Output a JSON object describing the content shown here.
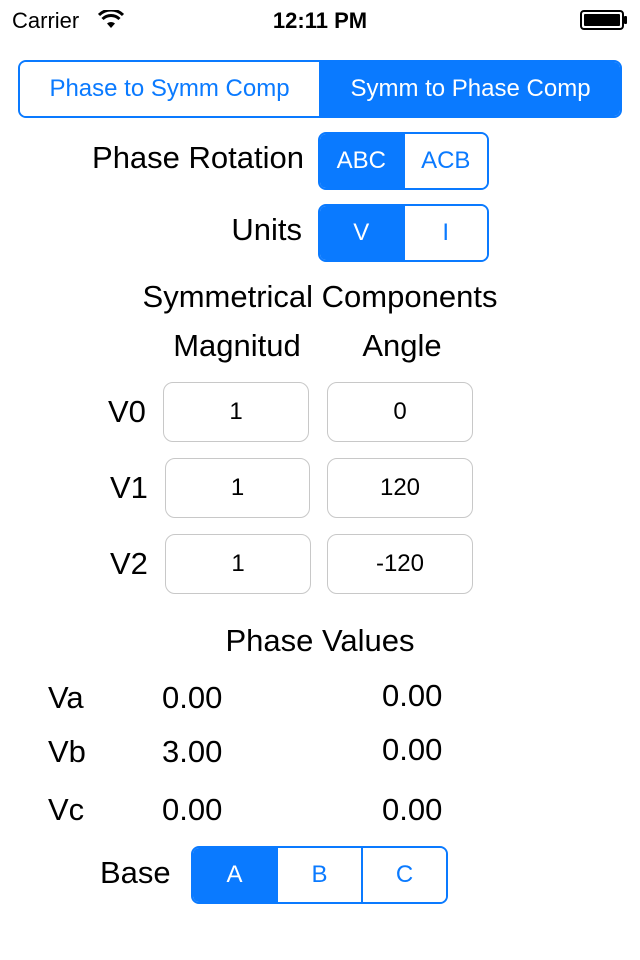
{
  "status_bar": {
    "carrier": "Carrier",
    "time": "12:11 PM"
  },
  "mode_tabs": {
    "options": [
      "Phase to Symm Comp",
      "Symm to Phase Comp"
    ],
    "selected": 1
  },
  "phase_rotation": {
    "label": "Phase Rotation",
    "options": [
      "ABC",
      "ACB"
    ],
    "selected": 0
  },
  "units": {
    "label": "Units",
    "options": [
      "V",
      "I"
    ],
    "selected": 0
  },
  "symmetrical_components": {
    "title": "Symmetrical Components",
    "col_magnitude": "Magnitud",
    "col_angle": "Angle",
    "rows": [
      {
        "label": "V0",
        "magnitude": "1",
        "angle": "0"
      },
      {
        "label": "V1",
        "magnitude": "1",
        "angle": "120"
      },
      {
        "label": "V2",
        "magnitude": "1",
        "angle": "-120"
      }
    ]
  },
  "phase_values": {
    "title": "Phase Values",
    "rows": [
      {
        "label": "Va",
        "magnitude": "0.00",
        "angle": "0.00"
      },
      {
        "label": "Vb",
        "magnitude": "3.00",
        "angle": "0.00"
      },
      {
        "label": "Vc",
        "magnitude": "0.00",
        "angle": "0.00"
      }
    ]
  },
  "base": {
    "label": "Base",
    "options": [
      "A",
      "B",
      "C"
    ],
    "selected": 0
  },
  "colors": {
    "accent": "#0a7aff",
    "field_border": "#c8c8c8"
  }
}
